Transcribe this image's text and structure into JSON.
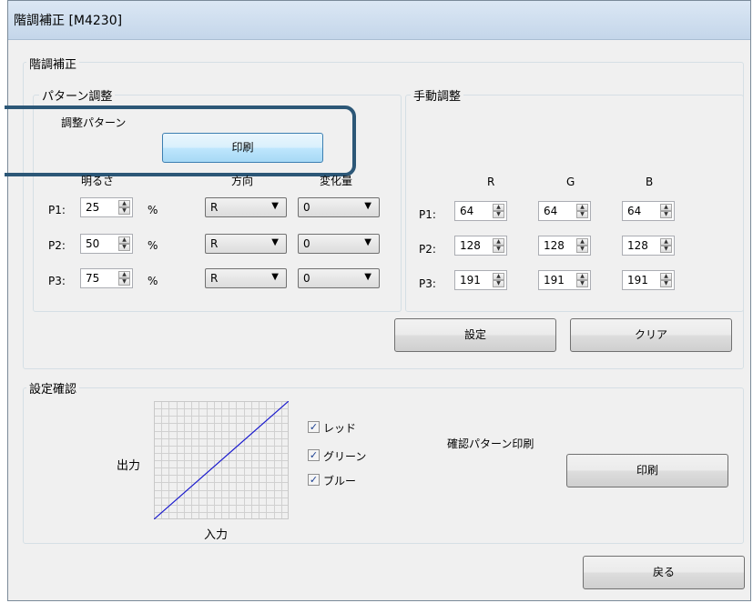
{
  "window": {
    "title": "階調補正 [M4230]"
  },
  "tone_group": {
    "label": "階調補正"
  },
  "pattern": {
    "label": "パターン調整",
    "callout_label": "調整パターン",
    "print_label": "印刷",
    "headers": {
      "brightness": "明るさ",
      "direction": "方向",
      "amount": "変化量"
    },
    "rows": [
      {
        "label": "P1:",
        "value": "25",
        "unit": "%",
        "direction": "R",
        "amount": "0"
      },
      {
        "label": "P2:",
        "value": "50",
        "unit": "%",
        "direction": "R",
        "amount": "0"
      },
      {
        "label": "P3:",
        "value": "75",
        "unit": "%",
        "direction": "R",
        "amount": "0"
      }
    ]
  },
  "manual": {
    "label": "手動調整",
    "headers": {
      "r": "R",
      "g": "G",
      "b": "B"
    },
    "rows": [
      {
        "label": "P1:",
        "r": "64",
        "g": "64",
        "b": "64"
      },
      {
        "label": "P2:",
        "r": "128",
        "g": "128",
        "b": "128"
      },
      {
        "label": "P3:",
        "r": "191",
        "g": "191",
        "b": "191"
      }
    ],
    "set_label": "設定",
    "clear_label": "クリア"
  },
  "confirm": {
    "label": "設定確認",
    "graph": {
      "y_label": "出力",
      "x_label": "入力",
      "line_color": "#1a1acd"
    },
    "checkboxes": [
      {
        "label": "レッド",
        "checked": true
      },
      {
        "label": "グリーン",
        "checked": true
      },
      {
        "label": "ブルー",
        "checked": true
      }
    ],
    "print_caption": "確認パターン印刷",
    "print_label": "印刷"
  },
  "back_label": "戻る"
}
